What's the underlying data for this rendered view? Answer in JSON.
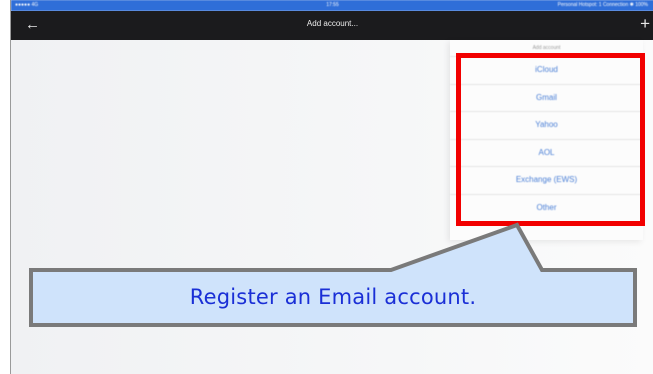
{
  "status_bar": {
    "carrier": "●●●●● 4G",
    "time": "17:55",
    "right": "Personal Hotspot: 1 Connection   ✱ 100%"
  },
  "nav": {
    "back_icon": "←",
    "title": "Add account...",
    "add_icon": "+"
  },
  "popover": {
    "header": "Add account",
    "items": [
      {
        "label": "iCloud"
      },
      {
        "label": "Gmail"
      },
      {
        "label": "Yahoo"
      },
      {
        "label": "AOL"
      },
      {
        "label": "Exchange (EWS)"
      },
      {
        "label": "Other"
      }
    ]
  },
  "callout": {
    "text": "Register an Email account.",
    "fill": "#cfe3fb",
    "border": "#7a7a7a",
    "text_color": "#1a2fd6"
  },
  "colors": {
    "highlight": "#f20000",
    "status_bar": "#2f6ed8",
    "nav_bar": "#1b1b1d",
    "link": "#4a7fd6"
  }
}
